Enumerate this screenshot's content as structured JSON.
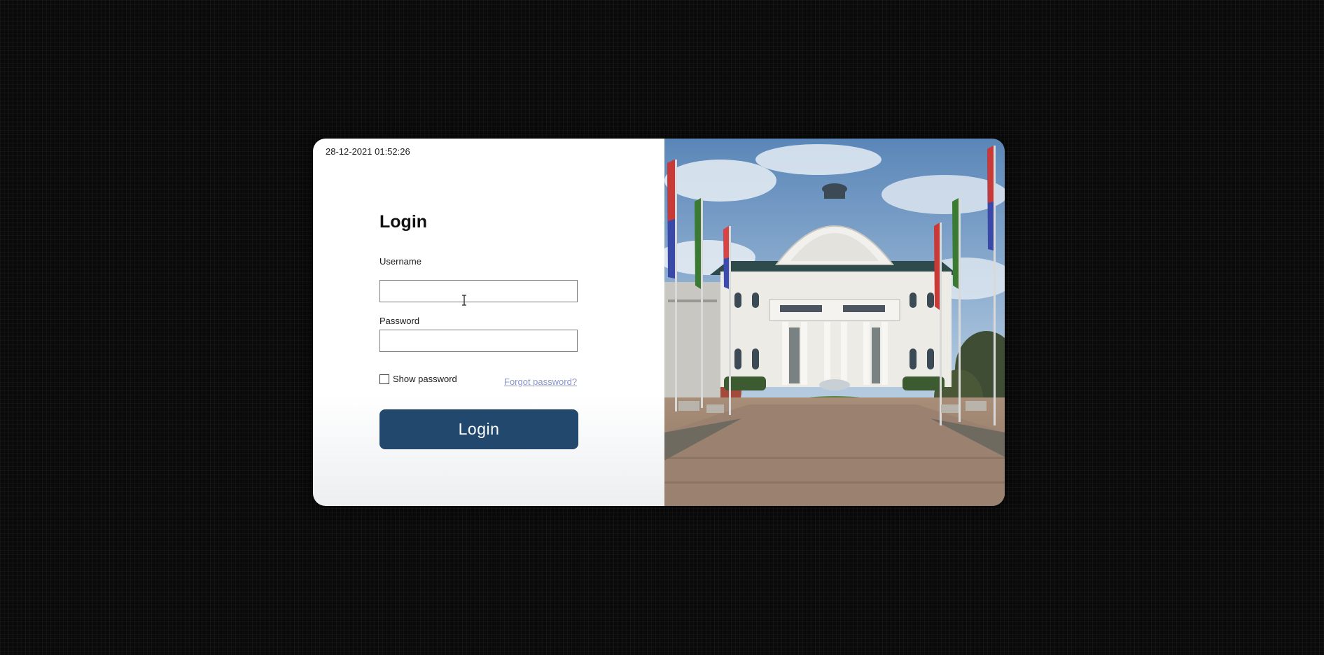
{
  "clock": "28-12-2021 01:52:26",
  "login": {
    "title": "Login",
    "username_label": "Username",
    "username_value": "",
    "password_label": "Password",
    "password_value": "",
    "show_password_label": "Show password",
    "show_password_checked": false,
    "forgot_password": "Forgot password?",
    "button_label": "Login"
  },
  "colors": {
    "button": "#22486d",
    "link": "#8a94c8"
  },
  "icons": {
    "cursor": "text-cursor-icon",
    "photo": "city-hall-photo"
  }
}
